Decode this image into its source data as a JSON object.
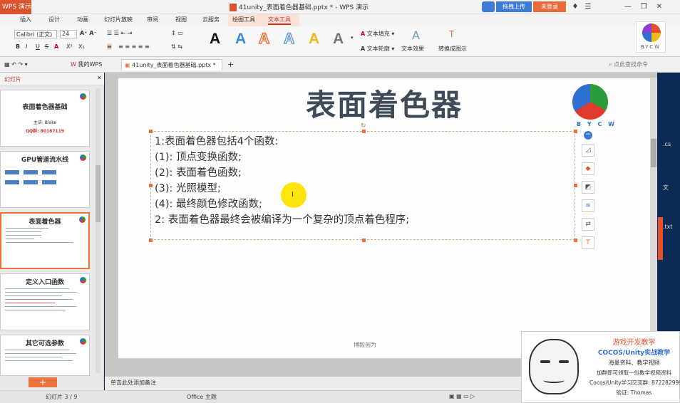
{
  "titlebar": {
    "app_name": "WPS 演示",
    "document_title": "41unity_表面着色器基础.pptx * - WPS 演示",
    "upload_label": "拖拽上传",
    "login_label": "未登录",
    "window_controls": [
      "♦",
      "☰",
      "—",
      "❐",
      "✕"
    ]
  },
  "ribbon_tabs": {
    "tabs": [
      "插入",
      "设计",
      "动画",
      "幻灯片放映",
      "审阅",
      "视图",
      "云服务",
      "绘图工具",
      "文本工具"
    ],
    "active": "文本工具"
  },
  "ribbon": {
    "font_name": "Calibri (正文)",
    "font_size": "24",
    "format_buttons": [
      "B",
      "I",
      "U",
      "S",
      "A",
      "X²",
      "X₂"
    ],
    "wordart_letters": [
      "A",
      "A",
      "A",
      "A",
      "A",
      "A"
    ],
    "text_fill_label": "文本填充",
    "text_outline_label": "文本轮廓",
    "text_effect_label": "文本效果",
    "convert_smartart_label": "转换成图示",
    "logo_text": "BYCW"
  },
  "quick_row": {
    "my_wps_label": "我的WPS",
    "file_tab_label": "41unity_表面着色器基础.pptx *",
    "new_tab_symbol": "+",
    "search_placeholder": "点此查找命令"
  },
  "left_pane": {
    "header_label": "幻灯片",
    "close_symbol": "✕",
    "thumbnails": [
      {
        "title": "表面着色器基础",
        "line1": "主讲: Blake",
        "line2": "QQ群: 80187119"
      },
      {
        "title": "GPU管道流水线"
      },
      {
        "title": "表面着色器"
      },
      {
        "title": "定义入口函数"
      },
      {
        "title": "其它可选参数"
      }
    ],
    "add_symbol": "+"
  },
  "slide": {
    "title": "表面着色器",
    "lines": [
      "1:表面着色器包括4个函数:",
      "  (1): 顶点变换函数;",
      "  (2): 表面着色函数;",
      "  (3): 光照模型;",
      "  (4): 最终颜色修改函数;",
      "2: 表面着色器最终会被编译为一个复杂的顶点着色程序;"
    ],
    "logo_text": "B Y C W",
    "watermark": "博毅创为"
  },
  "notes": {
    "placeholder": "单击此处添加备注"
  },
  "statusbar": {
    "slide_counter": "幻灯片 3 / 9",
    "theme": "Office 主题"
  },
  "right_strip": {
    "items": [
      ".cs",
      "文",
      ".txt"
    ]
  },
  "ad": {
    "title": "游戏开发教学",
    "subtitle": "COCOS/Unity实战教学",
    "line1": "海量资料、教学视频",
    "line2": "加群即可领取一份教学视频资料",
    "line3": "Cocos/Unity学习交流群: 872282999",
    "line4": "验证: Thomas"
  },
  "colors": {
    "accent": "#e8733b",
    "active_tab": "#cc3333",
    "title_text": "#3e4a57",
    "ad_title": "#e8502c",
    "ad_subtitle": "#2f6fd1"
  }
}
